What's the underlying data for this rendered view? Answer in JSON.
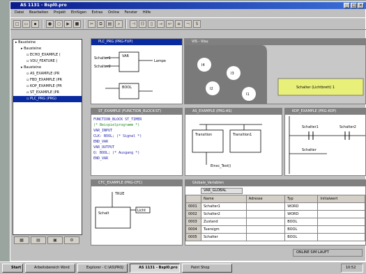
{
  "app": {
    "title": "AS 1131 - Bspl0.pro",
    "controls": [
      "_",
      "□",
      "×"
    ]
  },
  "menu": [
    "Datei",
    "Bearbeiten",
    "Projekt",
    "Einfügen",
    "Extras",
    "Online",
    "Fenster",
    "Hilfe"
  ],
  "tree": {
    "items": [
      {
        "label": "Bausteine",
        "indent": 0
      },
      {
        "label": "Bausteine",
        "indent": 1
      },
      {
        "label": "ECHO_EXAMPLE (",
        "indent": 2
      },
      {
        "label": "VDU_FEATURE (",
        "indent": 2
      },
      {
        "label": "Bausteine",
        "indent": 1
      },
      {
        "label": "AS_EXAMPLE (PR",
        "indent": 2
      },
      {
        "label": "FBD_EXAMPLE (PR",
        "indent": 2
      },
      {
        "label": "KOP_EXAMPLE (PR",
        "indent": 2
      },
      {
        "label": "ST_EXAMPLE (PR",
        "indent": 2
      },
      {
        "label": "PLC_PRG (PRG)",
        "indent": 2,
        "selected": true
      }
    ]
  },
  "windows": {
    "fbd_title": "PLC_PRG (PRG-FUP)",
    "fbd_labels": [
      "VAR",
      "BOOL",
      "Schalter1",
      "Schalter2",
      "Lampe"
    ],
    "vis_title": "VIS - Visu",
    "vis_circles": [
      "I4",
      "I3",
      "I2",
      "I1"
    ],
    "vis_button": "Schalter (Lichtbrett) 1",
    "st_title": "ST_EXAMPLE (FUNCTION_BLOCK-ST)",
    "st_lines": [
      "FUNCTION_BLOCK ST_TIMER",
      "(* Beispielprogramm *)",
      "VAR_INPUT",
      "    CLK: BOOL;  (* Signal *)",
      "END_VAR",
      "VAR_OUTPUT",
      "    Q: BOOL;  (* Ausgang *)",
      "END_VAR"
    ],
    "as_title": "AS_EXAMPLE (PRG-AS)",
    "as_labels": [
      "Transition",
      "Transition1",
      "Einsc_Test()"
    ],
    "kop_title": "KOP_EXAMPLE (PRG-KOP)",
    "kop_labels": [
      "Schalter1",
      "Schalter2",
      "Schalter"
    ],
    "cfc_title": "CFC_EXAMPLE (PRG-CFC)",
    "cfc_labels": [
      "Schalt",
      "TRUE",
      "Licht"
    ],
    "var_title": "Globale_Variablen",
    "var_tab": "VAR_GLOBAL",
    "var_headers": [
      "Name",
      "Adresse",
      "Typ",
      "Initialwert"
    ],
    "var_rows": [
      {
        "num": "0001",
        "name": "Schalter1",
        "addr": "",
        "type": "WORD",
        "init": ""
      },
      {
        "num": "0002",
        "name": "Schalter2",
        "addr": "",
        "type": "WORD",
        "init": ""
      },
      {
        "num": "0003",
        "name": "Zustand",
        "addr": "",
        "type": "BOOL",
        "init": ""
      },
      {
        "num": "0004",
        "name": "Tuersigm",
        "addr": "",
        "type": "BOOL",
        "init": ""
      },
      {
        "num": "0005",
        "name": "Schalter",
        "addr": "",
        "type": "BOOL",
        "init": ""
      }
    ]
  },
  "statusbar": "ONLINE  SIM  LAUFT",
  "taskbar": {
    "start": "Start",
    "items": [
      "Arbeitsbereich Word",
      "Explorer - C:\\AS\\PROJ",
      "AS 1131 - Bspl0.pro",
      "Paint Shop"
    ],
    "active_index": 2,
    "clock": "10:52"
  },
  "colors": {
    "titlebar": "#0a1c8c",
    "vis_button": "#e8f07a",
    "vis_panel": "#7a7a7a"
  }
}
